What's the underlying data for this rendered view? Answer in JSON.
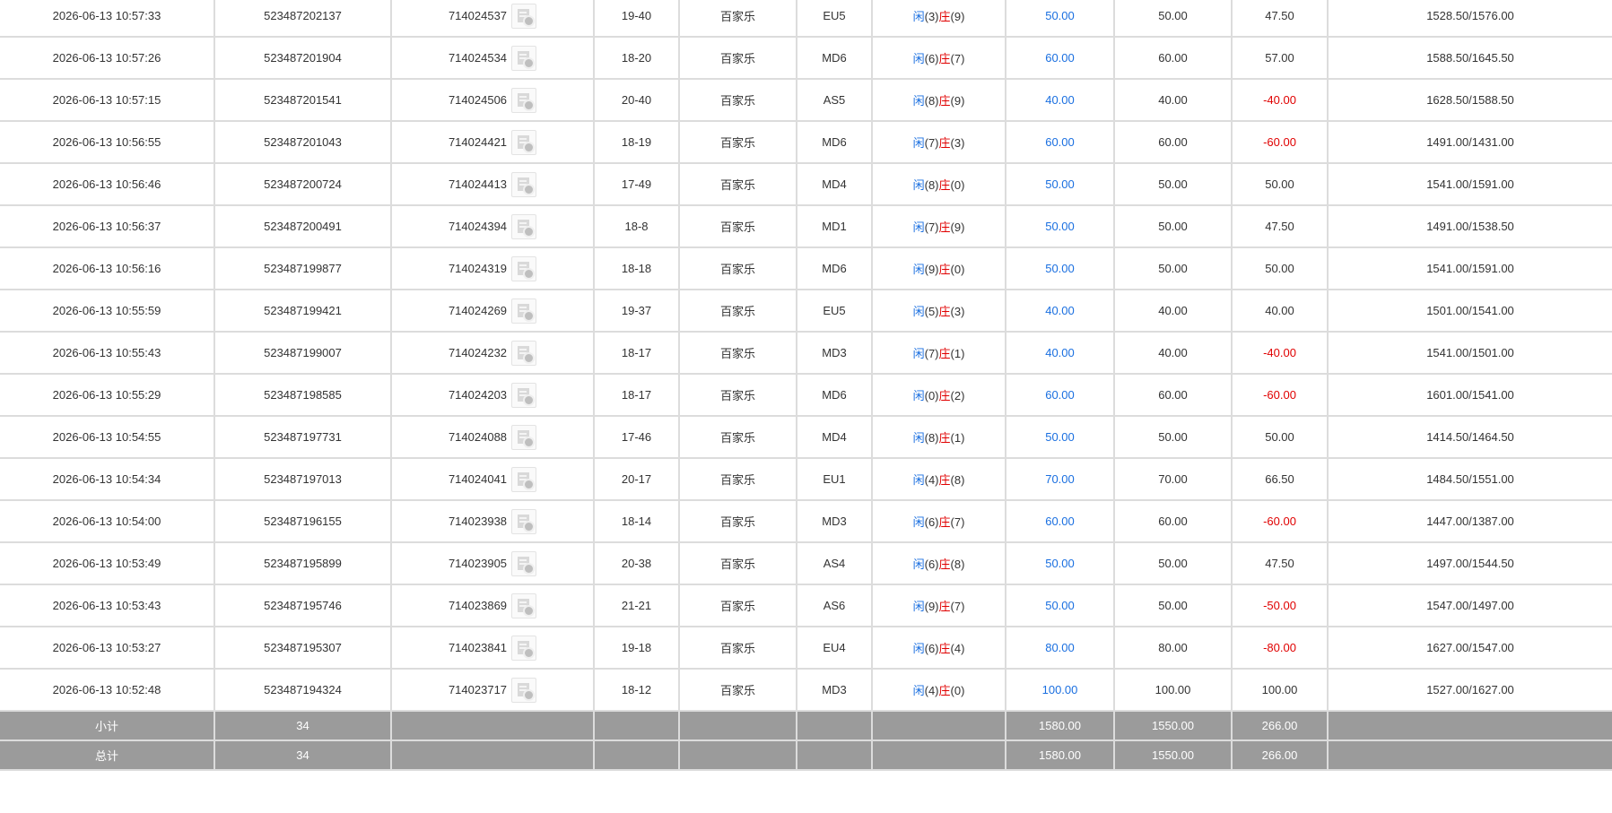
{
  "rows": [
    {
      "time": "2026-06-13 10:57:33",
      "order_id": "523487202137",
      "round_id": "714024537",
      "table": "19-40",
      "game": "百家乐",
      "shoe": "EU5",
      "player_label": "闲",
      "player_score": "(3)",
      "banker_label": "庄",
      "banker_score": "(9)",
      "bet": "50.00",
      "valid": "50.00",
      "winlose": "47.50",
      "winlose_color": "#333333",
      "balance": "1528.50/1576.00"
    },
    {
      "time": "2026-06-13 10:57:26",
      "order_id": "523487201904",
      "round_id": "714024534",
      "table": "18-20",
      "game": "百家乐",
      "shoe": "MD6",
      "player_label": "闲",
      "player_score": "(6)",
      "banker_label": "庄",
      "banker_score": "(7)",
      "bet": "60.00",
      "valid": "60.00",
      "winlose": "57.00",
      "winlose_color": "#333333",
      "balance": "1588.50/1645.50"
    },
    {
      "time": "2026-06-13 10:57:15",
      "order_id": "523487201541",
      "round_id": "714024506",
      "table": "20-40",
      "game": "百家乐",
      "shoe": "AS5",
      "player_label": "闲",
      "player_score": "(8)",
      "banker_label": "庄",
      "banker_score": "(9)",
      "bet": "40.00",
      "valid": "40.00",
      "winlose": "-40.00",
      "winlose_color": "#e00000",
      "balance": "1628.50/1588.50"
    },
    {
      "time": "2026-06-13 10:56:55",
      "order_id": "523487201043",
      "round_id": "714024421",
      "table": "18-19",
      "game": "百家乐",
      "shoe": "MD6",
      "player_label": "闲",
      "player_score": "(7)",
      "banker_label": "庄",
      "banker_score": "(3)",
      "bet": "60.00",
      "valid": "60.00",
      "winlose": "-60.00",
      "winlose_color": "#e00000",
      "balance": "1491.00/1431.00"
    },
    {
      "time": "2026-06-13 10:56:46",
      "order_id": "523487200724",
      "round_id": "714024413",
      "table": "17-49",
      "game": "百家乐",
      "shoe": "MD4",
      "player_label": "闲",
      "player_score": "(8)",
      "banker_label": "庄",
      "banker_score": "(0)",
      "bet": "50.00",
      "valid": "50.00",
      "winlose": "50.00",
      "winlose_color": "#333333",
      "balance": "1541.00/1591.00"
    },
    {
      "time": "2026-06-13 10:56:37",
      "order_id": "523487200491",
      "round_id": "714024394",
      "table": "18-8",
      "game": "百家乐",
      "shoe": "MD1",
      "player_label": "闲",
      "player_score": "(7)",
      "banker_label": "庄",
      "banker_score": "(9)",
      "bet": "50.00",
      "valid": "50.00",
      "winlose": "47.50",
      "winlose_color": "#333333",
      "balance": "1491.00/1538.50"
    },
    {
      "time": "2026-06-13 10:56:16",
      "order_id": "523487199877",
      "round_id": "714024319",
      "table": "18-18",
      "game": "百家乐",
      "shoe": "MD6",
      "player_label": "闲",
      "player_score": "(9)",
      "banker_label": "庄",
      "banker_score": "(0)",
      "bet": "50.00",
      "valid": "50.00",
      "winlose": "50.00",
      "winlose_color": "#333333",
      "balance": "1541.00/1591.00"
    },
    {
      "time": "2026-06-13 10:55:59",
      "order_id": "523487199421",
      "round_id": "714024269",
      "table": "19-37",
      "game": "百家乐",
      "shoe": "EU5",
      "player_label": "闲",
      "player_score": "(5)",
      "banker_label": "庄",
      "banker_score": "(3)",
      "bet": "40.00",
      "valid": "40.00",
      "winlose": "40.00",
      "winlose_color": "#333333",
      "balance": "1501.00/1541.00"
    },
    {
      "time": "2026-06-13 10:55:43",
      "order_id": "523487199007",
      "round_id": "714024232",
      "table": "18-17",
      "game": "百家乐",
      "shoe": "MD3",
      "player_label": "闲",
      "player_score": "(7)",
      "banker_label": "庄",
      "banker_score": "(1)",
      "bet": "40.00",
      "valid": "40.00",
      "winlose": "-40.00",
      "winlose_color": "#e00000",
      "balance": "1541.00/1501.00"
    },
    {
      "time": "2026-06-13 10:55:29",
      "order_id": "523487198585",
      "round_id": "714024203",
      "table": "18-17",
      "game": "百家乐",
      "shoe": "MD6",
      "player_label": "闲",
      "player_score": "(0)",
      "banker_label": "庄",
      "banker_score": "(2)",
      "bet": "60.00",
      "valid": "60.00",
      "winlose": "-60.00",
      "winlose_color": "#e00000",
      "balance": "1601.00/1541.00"
    },
    {
      "time": "2026-06-13 10:54:55",
      "order_id": "523487197731",
      "round_id": "714024088",
      "table": "17-46",
      "game": "百家乐",
      "shoe": "MD4",
      "player_label": "闲",
      "player_score": "(8)",
      "banker_label": "庄",
      "banker_score": "(1)",
      "bet": "50.00",
      "valid": "50.00",
      "winlose": "50.00",
      "winlose_color": "#333333",
      "balance": "1414.50/1464.50"
    },
    {
      "time": "2026-06-13 10:54:34",
      "order_id": "523487197013",
      "round_id": "714024041",
      "table": "20-17",
      "game": "百家乐",
      "shoe": "EU1",
      "player_label": "闲",
      "player_score": "(4)",
      "banker_label": "庄",
      "banker_score": "(8)",
      "bet": "70.00",
      "valid": "70.00",
      "winlose": "66.50",
      "winlose_color": "#333333",
      "balance": "1484.50/1551.00"
    },
    {
      "time": "2026-06-13 10:54:00",
      "order_id": "523487196155",
      "round_id": "714023938",
      "table": "18-14",
      "game": "百家乐",
      "shoe": "MD3",
      "player_label": "闲",
      "player_score": "(6)",
      "banker_label": "庄",
      "banker_score": "(7)",
      "bet": "60.00",
      "valid": "60.00",
      "winlose": "-60.00",
      "winlose_color": "#e00000",
      "balance": "1447.00/1387.00"
    },
    {
      "time": "2026-06-13 10:53:49",
      "order_id": "523487195899",
      "round_id": "714023905",
      "table": "20-38",
      "game": "百家乐",
      "shoe": "AS4",
      "player_label": "闲",
      "player_score": "(6)",
      "banker_label": "庄",
      "banker_score": "(8)",
      "bet": "50.00",
      "valid": "50.00",
      "winlose": "47.50",
      "winlose_color": "#333333",
      "balance": "1497.00/1544.50"
    },
    {
      "time": "2026-06-13 10:53:43",
      "order_id": "523487195746",
      "round_id": "714023869",
      "table": "21-21",
      "game": "百家乐",
      "shoe": "AS6",
      "player_label": "闲",
      "player_score": "(9)",
      "banker_label": "庄",
      "banker_score": "(7)",
      "bet": "50.00",
      "valid": "50.00",
      "winlose": "-50.00",
      "winlose_color": "#e00000",
      "balance": "1547.00/1497.00"
    },
    {
      "time": "2026-06-13 10:53:27",
      "order_id": "523487195307",
      "round_id": "714023841",
      "table": "19-18",
      "game": "百家乐",
      "shoe": "EU4",
      "player_label": "闲",
      "player_score": "(6)",
      "banker_label": "庄",
      "banker_score": "(4)",
      "bet": "80.00",
      "valid": "80.00",
      "winlose": "-80.00",
      "winlose_color": "#e00000",
      "balance": "1627.00/1547.00"
    },
    {
      "time": "2026-06-13 10:52:48",
      "order_id": "523487194324",
      "round_id": "714023717",
      "table": "18-12",
      "game": "百家乐",
      "shoe": "MD3",
      "player_label": "闲",
      "player_score": "(4)",
      "banker_label": "庄",
      "banker_score": "(0)",
      "bet": "100.00",
      "valid": "100.00",
      "winlose": "100.00",
      "winlose_color": "#333333",
      "balance": "1527.00/1627.00"
    }
  ],
  "subtotal": {
    "label": "小计",
    "count": "34",
    "bet": "1580.00",
    "valid": "1550.00",
    "winlose": "266.00"
  },
  "total": {
    "label": "总计",
    "count": "34",
    "bet": "1580.00",
    "valid": "1550.00",
    "winlose": "266.00"
  },
  "colors": {
    "bet_blue": "#1a6fe0",
    "loss_red": "#e00000",
    "summary_bg": "#9b9b9b"
  },
  "icons": {
    "round_detail": "video-replay-icon"
  }
}
